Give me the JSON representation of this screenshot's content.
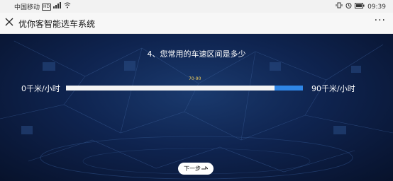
{
  "status_bar": {
    "carrier": "中国移动",
    "hd": "HD",
    "signal": "4G",
    "time": "09:39"
  },
  "title_bar": {
    "title": "优你客智能选车系统",
    "more": "···"
  },
  "question": {
    "text": "4、您常用的车速区间是多少",
    "range_value": "70-90",
    "min_label": "0千米/小时",
    "max_label": "90千米/小时",
    "fill_fraction": 0.88
  },
  "next_button": {
    "label": "下一步"
  },
  "colors": {
    "track": "#2f86e6",
    "fill": "#f4f4f4",
    "range_value": "#f5d15a"
  }
}
